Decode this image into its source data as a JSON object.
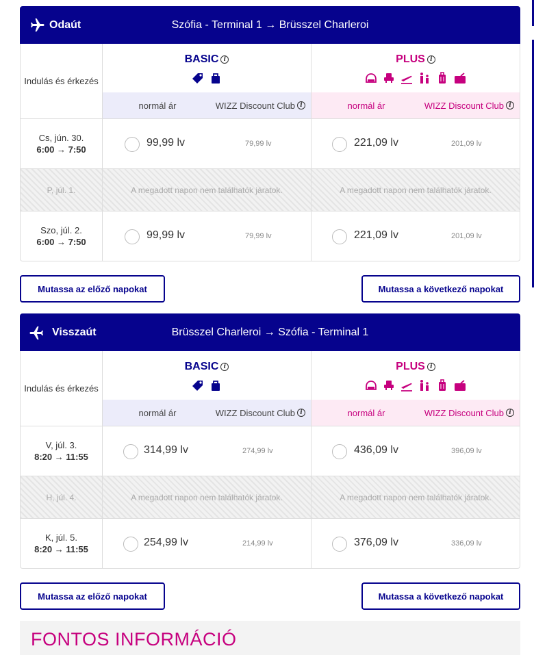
{
  "outbound": {
    "direction": "Odaút",
    "route": "Szófia - Terminal 1 → Brüsszel Charleroi",
    "departure_header": "Indulás és érkezés",
    "basic_label": "BASIC",
    "plus_label": "PLUS",
    "normal_label_basic": "normál ár",
    "club_label_basic": "WIZZ Discount Club",
    "normal_label_plus": "normál ár",
    "club_label_plus": "WIZZ Discount Club",
    "rows": [
      {
        "date": "Cs, jún. 30.",
        "time": "6:00 → 7:50",
        "basic_price": "99,99 lv",
        "basic_club": "79,99 lv",
        "plus_price": "221,09 lv",
        "plus_club": "201,09 lv"
      },
      {
        "date": "P, júl. 1.",
        "empty_text_basic": "A megadott napon nem találhatók járatok.",
        "empty_text_plus": "A megadott napon nem találhatók járatok."
      },
      {
        "date": "Szo, júl. 2.",
        "time": "6:00 → 7:50",
        "basic_price": "99,99 lv",
        "basic_club": "79,99 lv",
        "plus_price": "221,09 lv",
        "plus_club": "201,09 lv"
      }
    ],
    "prev_button": "Mutassa az előző napokat",
    "next_button": "Mutassa a következő napokat"
  },
  "return": {
    "direction": "Visszaút",
    "route": "Brüsszel Charleroi → Szófia - Terminal 1",
    "departure_header": "Indulás és érkezés",
    "basic_label": "BASIC",
    "plus_label": "PLUS",
    "normal_label_basic": "normál ár",
    "club_label_basic": "WIZZ Discount Club",
    "normal_label_plus": "normál ár",
    "club_label_plus": "WIZZ Discount Club",
    "rows": [
      {
        "date": "V, júl. 3.",
        "time": "8:20 → 11:55",
        "basic_price": "314,99 lv",
        "basic_club": "274,99 lv",
        "plus_price": "436,09 lv",
        "plus_club": "396,09 lv"
      },
      {
        "date": "H, júl. 4.",
        "empty_text_basic": "A megadott napon nem találhatók járatok.",
        "empty_text_plus": "A megadott napon nem találhatók járatok."
      },
      {
        "date": "K, júl. 5.",
        "time": "8:20 → 11:55",
        "basic_price": "254,99 lv",
        "basic_club": "214,99 lv",
        "plus_price": "376,09 lv",
        "plus_club": "336,09 lv"
      }
    ],
    "prev_button": "Mutassa az előző napokat",
    "next_button": "Mutassa a következő napokat"
  },
  "info": {
    "title": "FONTOS INFORMÁCIÓ"
  },
  "info_icon": "i",
  "colors": {
    "navy": "#06038d",
    "magenta": "#c6007e"
  },
  "icons": {
    "basic": [
      "tag-icon",
      "bag-icon"
    ],
    "plus": [
      "seat-icon",
      "seat-selection-icon",
      "plane-takeoff-icon",
      "family-icon",
      "luggage-icon",
      "briefcase-icon"
    ]
  }
}
